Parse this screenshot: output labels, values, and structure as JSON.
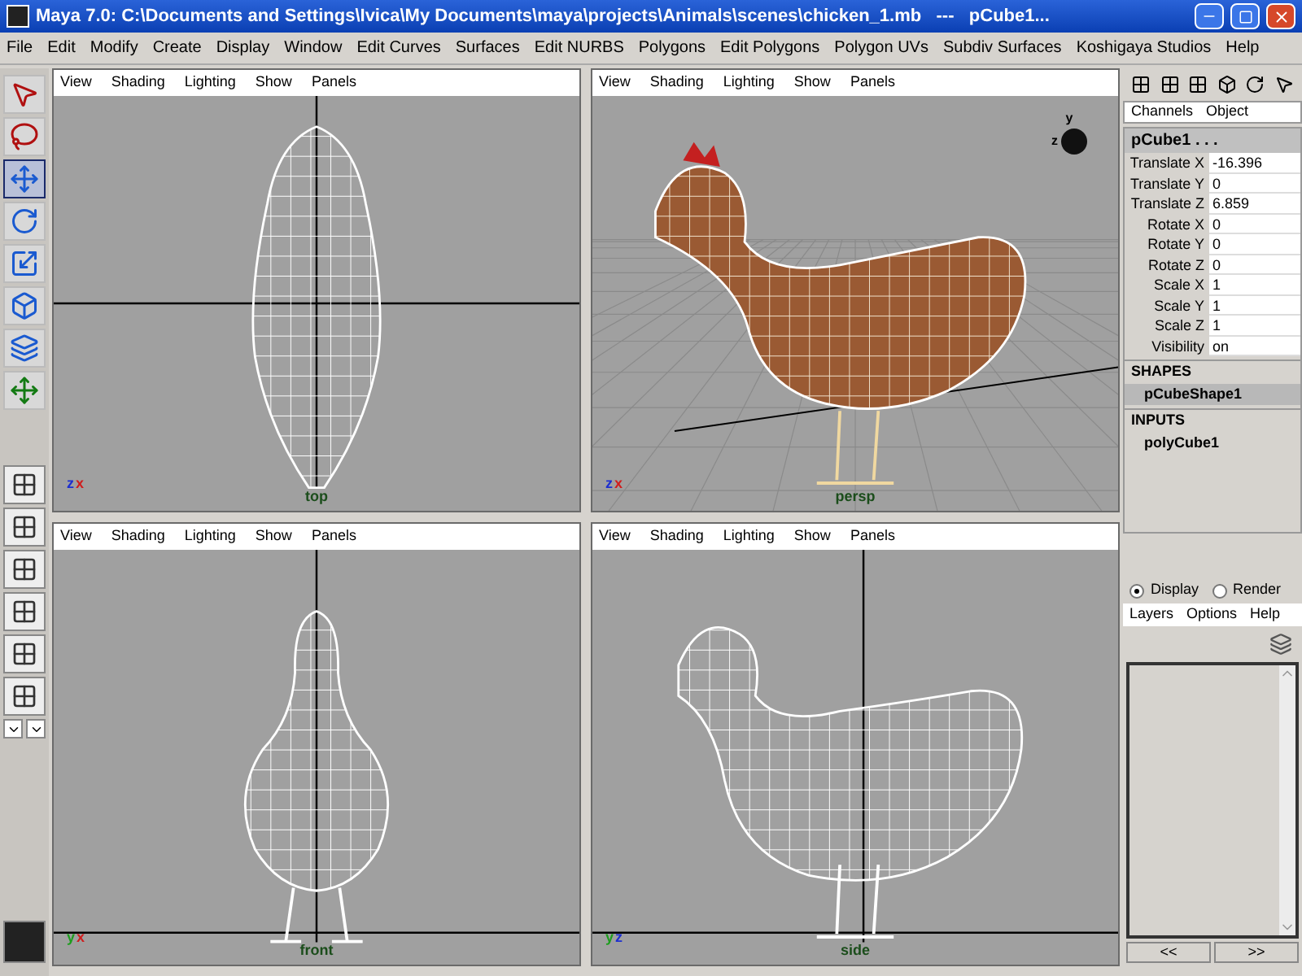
{
  "window": {
    "title": "Maya 7.0: C:\\Documents and Settings\\Ivica\\My Documents\\maya\\projects\\Animals\\scenes\\chicken_1.mb   ---   pCube1..."
  },
  "menu": [
    "File",
    "Edit",
    "Modify",
    "Create",
    "Display",
    "Window",
    "Edit Curves",
    "Surfaces",
    "Edit NURBS",
    "Polygons",
    "Edit Polygons",
    "Polygon UVs",
    "Subdiv Surfaces",
    "Koshigaya Studios",
    "Help"
  ],
  "viewports": [
    {
      "kind": "top",
      "label": "top",
      "menu": [
        "View",
        "Shading",
        "Lighting",
        "Show",
        "Panels"
      ],
      "axes": [
        {
          "label": "z",
          "color": "#1d2fd0"
        },
        {
          "label": "x",
          "color": "#d01d1d"
        }
      ]
    },
    {
      "kind": "persp",
      "label": "persp",
      "menu": [
        "View",
        "Shading",
        "Lighting",
        "Show",
        "Panels"
      ],
      "axes": [
        {
          "label": "z",
          "color": "#1d2fd0"
        },
        {
          "label": "x",
          "color": "#d01d1d"
        }
      ],
      "compass_labels": [
        "y",
        "z"
      ]
    },
    {
      "kind": "front",
      "label": "front",
      "menu": [
        "View",
        "Shading",
        "Lighting",
        "Show",
        "Panels"
      ],
      "axes": [
        {
          "label": "y",
          "color": "#1d9d1d"
        },
        {
          "label": "x",
          "color": "#d01d1d"
        }
      ]
    },
    {
      "kind": "side",
      "label": "side",
      "menu": [
        "View",
        "Shading",
        "Lighting",
        "Show",
        "Panels"
      ],
      "axes": [
        {
          "label": "y",
          "color": "#1d9d1d"
        },
        {
          "label": "z",
          "color": "#1d2fd0"
        }
      ]
    }
  ],
  "channel_box": {
    "tabs": [
      "Channels",
      "Object"
    ],
    "object": "pCube1 . . .",
    "attributes": [
      {
        "name": "Translate X",
        "value": "-16.396"
      },
      {
        "name": "Translate Y",
        "value": "0"
      },
      {
        "name": "Translate Z",
        "value": "6.859"
      },
      {
        "name": "Rotate X",
        "value": "0"
      },
      {
        "name": "Rotate Y",
        "value": "0"
      },
      {
        "name": "Rotate Z",
        "value": "0"
      },
      {
        "name": "Scale X",
        "value": "1"
      },
      {
        "name": "Scale Y",
        "value": "1"
      },
      {
        "name": "Scale Z",
        "value": "1"
      },
      {
        "name": "Visibility",
        "value": "on"
      }
    ],
    "sections": [
      {
        "title": "SHAPES",
        "items": [
          {
            "label": "pCubeShape1",
            "selected": true
          }
        ]
      },
      {
        "title": "INPUTS",
        "items": [
          {
            "label": "polyCube1",
            "selected": false
          }
        ]
      }
    ]
  },
  "layers": {
    "modes": [
      {
        "label": "Display",
        "selected": true
      },
      {
        "label": "Render",
        "selected": false
      }
    ],
    "menu": [
      "Layers",
      "Options",
      "Help"
    ],
    "nav": [
      "<<",
      ">>"
    ]
  }
}
